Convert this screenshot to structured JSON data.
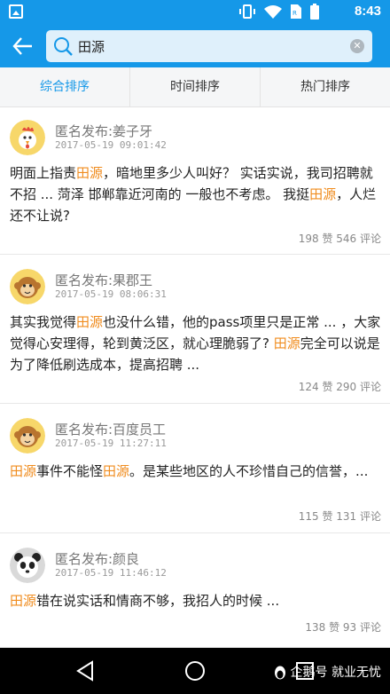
{
  "status_bar": {
    "time": "8:43",
    "icons": [
      "image-icon",
      "vibrate-icon",
      "wifi-icon",
      "sim-icon",
      "battery-icon"
    ]
  },
  "search": {
    "value": "田源",
    "placeholder": ""
  },
  "tabs": [
    {
      "label": "综合排序",
      "active": true
    },
    {
      "label": "时间排序",
      "active": false
    },
    {
      "label": "热门排序",
      "active": false
    }
  ],
  "posts": [
    {
      "author": "匿名发布:姜子牙",
      "time": "2017-05-19 09:01:42",
      "avatar": "rooster-avatar",
      "content": [
        {
          "t": "明面上指责",
          "h": false
        },
        {
          "t": "田源",
          "h": true
        },
        {
          "t": "，暗地里多少人叫好？ 实话实说，我司招聘就不招 ... 菏泽 邯郸靠近河南的 一般也不考虑。 我挺",
          "h": false
        },
        {
          "t": "田源",
          "h": true
        },
        {
          "t": "，人烂还不让说?",
          "h": false
        }
      ],
      "stats": "198 赞 546 评论"
    },
    {
      "author": "匿名发布:果郡王",
      "time": "2017-05-19 08:06:31",
      "avatar": "monkey-avatar",
      "content": [
        {
          "t": "其实我觉得",
          "h": false
        },
        {
          "t": "田源",
          "h": true
        },
        {
          "t": "也没什么错，他的pass项里只是正常 ... ，大家觉得心安理得，轮到黄泛区，就心理脆弱了? ",
          "h": false
        },
        {
          "t": "田源",
          "h": true
        },
        {
          "t": "完全可以说是为了降低刷选成本，提高招聘 ...",
          "h": false
        }
      ],
      "stats": "124 赞 290 评论"
    },
    {
      "author": "匿名发布:百度员工",
      "time": "2017-05-19 11:27:11",
      "avatar": "monkey-avatar",
      "content": [
        {
          "t": "田源",
          "h": true
        },
        {
          "t": "事件不能怪",
          "h": false
        },
        {
          "t": "田源",
          "h": true
        },
        {
          "t": "。是某些地区的人不珍惜自己的信誉，...",
          "h": false
        }
      ],
      "stats": "115 赞 131 评论"
    },
    {
      "author": "匿名发布:颜良",
      "time": "2017-05-19 11:46:12",
      "avatar": "panda-avatar",
      "content": [
        {
          "t": "田源",
          "h": true
        },
        {
          "t": "错在说实话和情商不够，我招人的时候 ...",
          "h": false
        }
      ],
      "stats": "138 赞 93 评论"
    }
  ],
  "watermark": "企鹅号 就业无忧",
  "colors": {
    "brand": "#1598e8",
    "highlight": "#f08c1e"
  }
}
